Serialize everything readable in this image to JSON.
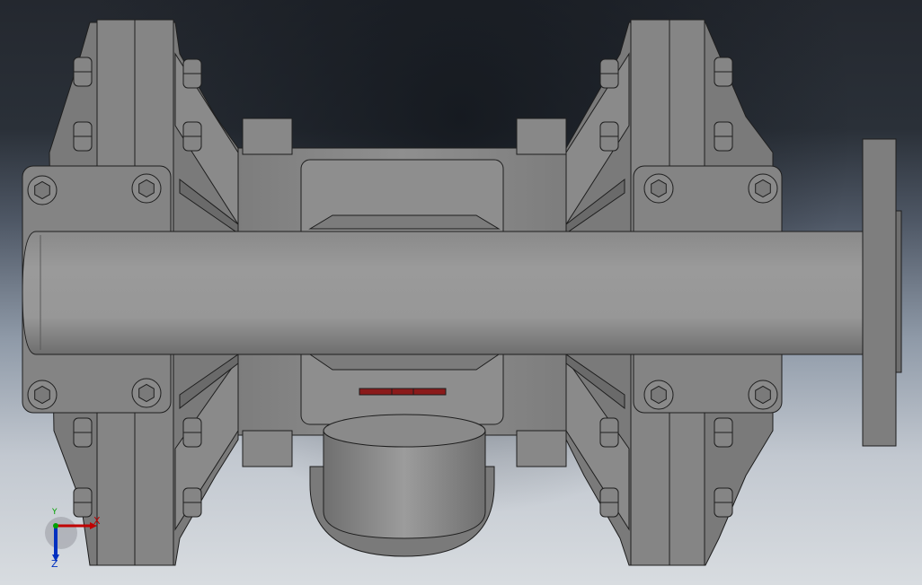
{
  "viewport": {
    "background_top": "#24282f",
    "background_bottom": "#d8dce0",
    "part_color": "#8c8c8c",
    "edge_color": "#1e1e1e",
    "indicator_color": "#8a1a1a"
  },
  "triad": {
    "x_label": "X",
    "y_label": "Y",
    "z_label": "Z",
    "x_color": "#c00000",
    "y_color": "#00a000",
    "z_color": "#0030c0"
  }
}
